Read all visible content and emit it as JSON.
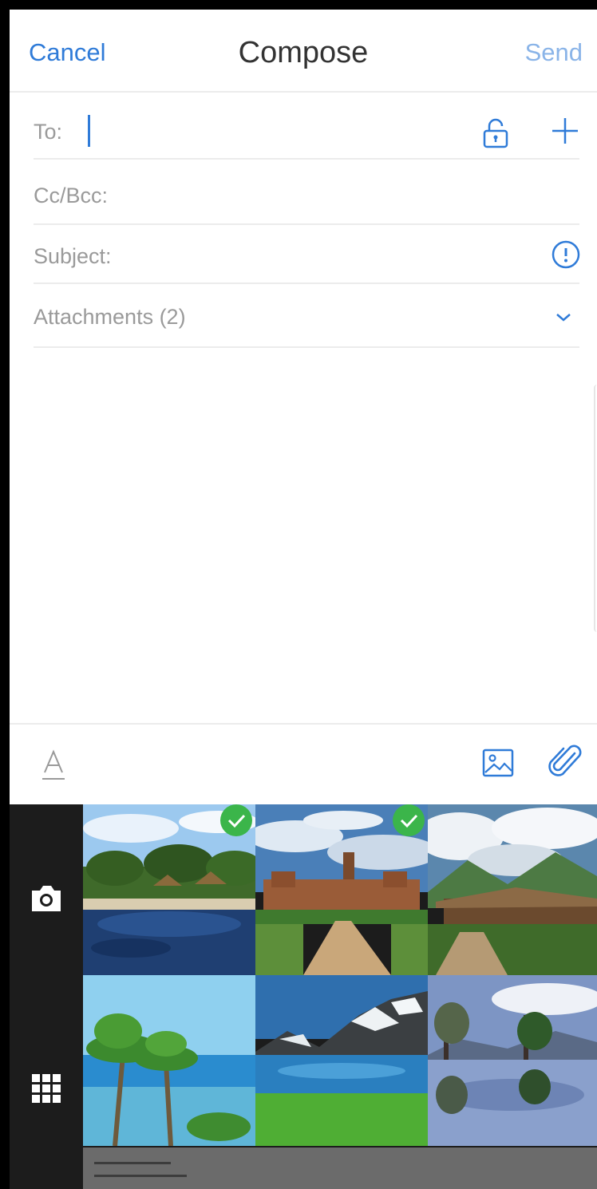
{
  "header": {
    "cancel_label": "Cancel",
    "title": "Compose",
    "send_label": "Send"
  },
  "fields": {
    "to_label": "To:",
    "to_value": "",
    "cc_label": "Cc/Bcc:",
    "subject_label": "Subject:",
    "attachments_label": "Attachments (2)"
  },
  "icons": {
    "lock": "lock-icon",
    "add_recipient": "plus-icon",
    "info": "info-icon",
    "expand": "chevron-down-icon",
    "font": "font-format-icon",
    "insert_image": "image-icon",
    "attach": "paperclip-icon",
    "camera": "camera-icon",
    "grid": "grid-icon",
    "selected": "check-icon"
  },
  "photos": [
    {
      "subject": "resort pool with thatched huts",
      "selected": true
    },
    {
      "subject": "palace with garden path",
      "selected": true
    },
    {
      "subject": "mountain village with clouds",
      "selected": false
    },
    {
      "subject": "palm trees by the sea",
      "selected": false
    },
    {
      "subject": "mountain lake with green meadow",
      "selected": false
    },
    {
      "subject": "lake reflection with trees",
      "selected": false
    }
  ],
  "colors": {
    "accent": "#2f7bd8",
    "send_disabled": "#8ab4e8",
    "selected_badge": "#3bb54a",
    "picker_background": "#1c1c1c"
  }
}
